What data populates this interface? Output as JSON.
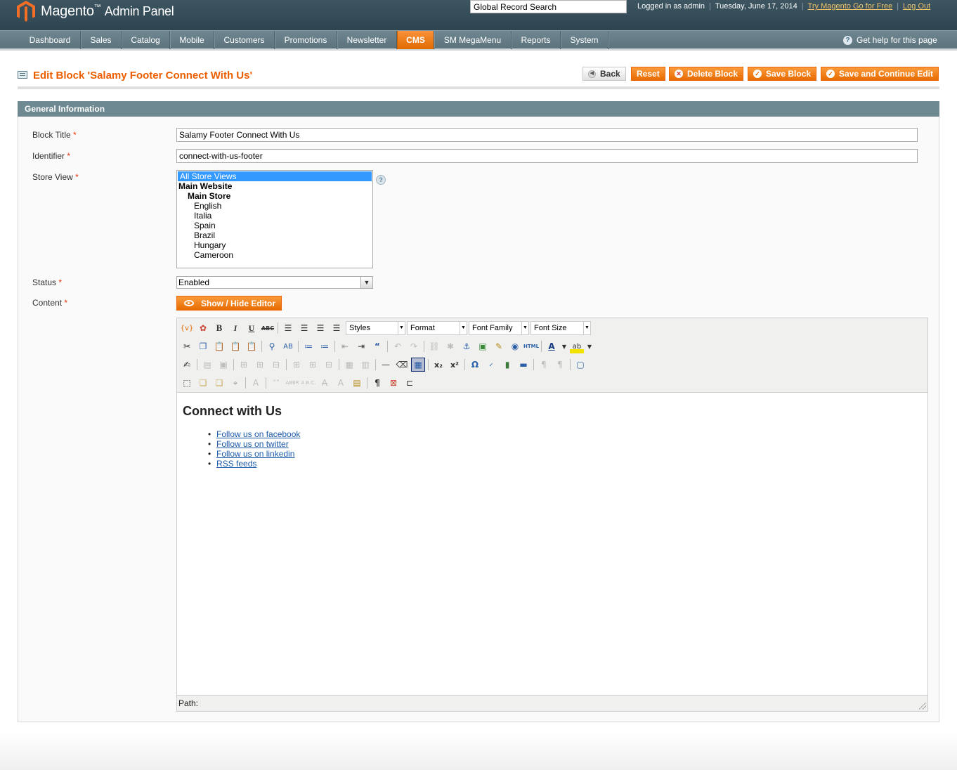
{
  "header": {
    "logo_text": "Magento",
    "logo_sub": "Admin Panel",
    "search_placeholder": "Global Record Search",
    "logged_in": "Logged in as admin",
    "date": "Tuesday, June 17, 2014",
    "try_link": "Try Magento Go for Free",
    "logout_link": "Log Out"
  },
  "nav": {
    "items": [
      "Dashboard",
      "Sales",
      "Catalog",
      "Mobile",
      "Customers",
      "Promotions",
      "Newsletter",
      "CMS",
      "SM MegaMenu",
      "Reports",
      "System"
    ],
    "active": "CMS",
    "help": "Get help for this page"
  },
  "page": {
    "title": "Edit Block 'Salamy Footer Connect With Us'",
    "buttons": {
      "back": "Back",
      "reset": "Reset",
      "delete": "Delete Block",
      "save": "Save Block",
      "save_continue": "Save and Continue Edit"
    }
  },
  "form": {
    "section_title": "General Information",
    "block_title_label": "Block Title",
    "block_title_value": "Salamy Footer Connect With Us",
    "identifier_label": "Identifier",
    "identifier_value": "connect-with-us-footer",
    "store_view_label": "Store View",
    "store_views": {
      "all": "All Store Views",
      "website": "Main Website",
      "store": "Main Store",
      "views": [
        "English",
        "Italia",
        "Spain",
        "Brazil",
        "Hungary",
        "Cameroon"
      ]
    },
    "status_label": "Status",
    "status_value": "Enabled",
    "content_label": "Content",
    "required_mark": "*",
    "show_hide_editor": "Show / Hide Editor"
  },
  "editor": {
    "dropdowns": {
      "styles": "Styles",
      "format": "Format",
      "font_family": "Font Family",
      "font_size": "Font Size"
    },
    "content": {
      "heading": "Connect with Us",
      "links": [
        "Follow us on facebook",
        "Follow us on twitter",
        "Follow us on linkedin",
        "RSS feeds"
      ]
    },
    "path_label": "Path:"
  }
}
